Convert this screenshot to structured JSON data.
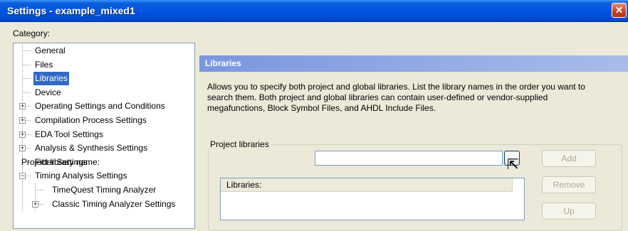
{
  "window": {
    "title": "Settings - example_mixed1",
    "close_glyph": "✕"
  },
  "category_label": "Category:",
  "tree": {
    "items": [
      {
        "label": "General",
        "expandable": false
      },
      {
        "label": "Files",
        "expandable": false
      },
      {
        "label": "Libraries",
        "expandable": false,
        "selected": true
      },
      {
        "label": "Device",
        "expandable": false
      },
      {
        "label": "Operating Settings and Conditions",
        "expandable": true,
        "expanded": false
      },
      {
        "label": "Compilation Process Settings",
        "expandable": true,
        "expanded": false
      },
      {
        "label": "EDA Tool Settings",
        "expandable": true,
        "expanded": false
      },
      {
        "label": "Analysis & Synthesis Settings",
        "expandable": true,
        "expanded": false
      },
      {
        "label": "Fitter Settings",
        "expandable": false
      },
      {
        "label": "Timing Analysis Settings",
        "expandable": true,
        "expanded": true
      },
      {
        "label": "TimeQuest Timing Analyzer",
        "expandable": false,
        "child": true
      },
      {
        "label": "Classic Timing Analyzer Settings",
        "expandable": true,
        "expanded": false,
        "child": true
      }
    ]
  },
  "panel": {
    "header": "Libraries",
    "description": "Allows you to specify both project and global libraries. List the library names in the order you want to search them. Both project and global libraries can contain user-defined or vendor-supplied megafunctions, Block Symbol Files, and AHDL Include Files.",
    "project_group": {
      "legend": "Project libraries",
      "name_label": "Project library name:",
      "name_value": "",
      "browse_label": "...",
      "add_label": "Add",
      "remove_label": "Remove",
      "up_label": "Up",
      "list_header": "Libraries:"
    }
  },
  "colors": {
    "title_bar": "#0054e3",
    "selection": "#316ac5",
    "panel_header_start": "#7a96df",
    "panel_header_end": "#a9bce9",
    "dialog_bg": "#ece9d8"
  }
}
